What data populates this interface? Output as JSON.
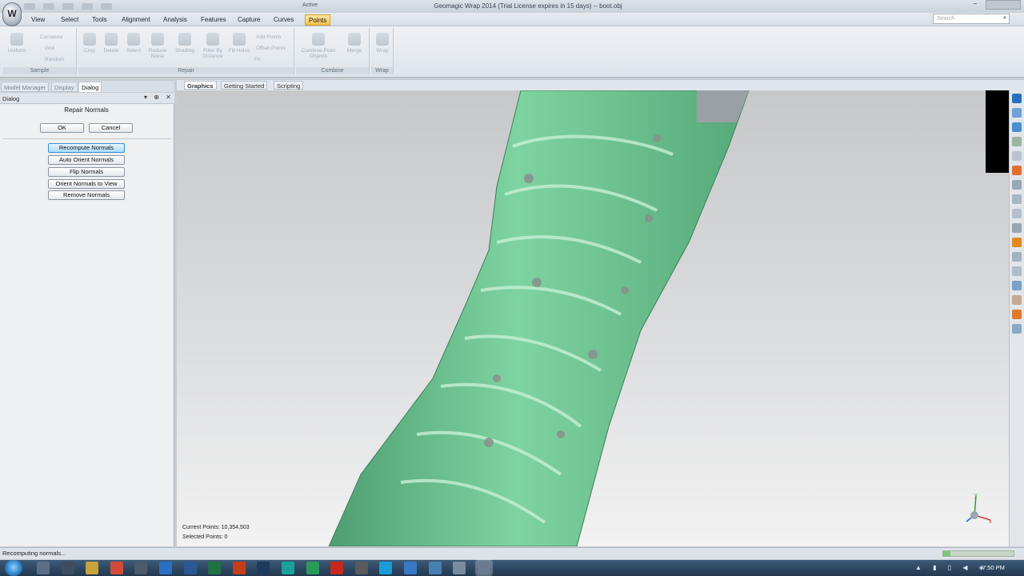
{
  "window": {
    "title": "Geomagic Wrap 2014 (Trial License expires in 15 days) -- boot.obj",
    "active_tag": "Active",
    "app_logo_letter": "W",
    "minimize_glyph": "–"
  },
  "menu": {
    "tabs": [
      "View",
      "Select",
      "Tools",
      "Alignment",
      "Analysis",
      "Features",
      "Capture",
      "Curves",
      "Points"
    ],
    "active": "Points"
  },
  "search": {
    "placeholder": "Search",
    "icon": "search-icon",
    "icon_glyph": "⌕"
  },
  "ribbon": {
    "groups": [
      {
        "label": "Sample",
        "buttons": [
          "Uniform"
        ],
        "small": [
          "Curvature",
          "Grid",
          "Random"
        ]
      },
      {
        "label": "Repair",
        "buttons": [
          "Crop",
          "Delete",
          "Select",
          "Reduce Noise",
          "Shading",
          "Filter By Distance",
          "Fill Holes"
        ],
        "small": [
          "Add Points",
          "Offset Points",
          "Fit"
        ]
      },
      {
        "label": "Combine",
        "buttons": [
          "Combine Point Objects",
          "Merge"
        ],
        "small": []
      },
      {
        "label": "Wrap",
        "buttons": [
          "Wrap"
        ],
        "small": []
      }
    ]
  },
  "panel": {
    "tabs": [
      "Model Manager",
      "Display",
      "Dialog"
    ],
    "active_tab": "Dialog",
    "header_title": "Dialog",
    "header_icons": "▾ ⊕ ✕",
    "dialog_title": "Repair Normals",
    "ok_label": "OK",
    "cancel_label": "Cancel",
    "actions": [
      "Recompute Normals",
      "Auto Orient Normals",
      "Flip Normals",
      "Orient Normals to View",
      "Remove Normals"
    ],
    "highlighted_action": "Recompute Normals"
  },
  "viewport": {
    "tabs": [
      "Graphics",
      "Getting Started",
      "Scripting"
    ],
    "active_tab": "Graphics",
    "current_points": "Current Points: 10,354,503",
    "selected_points": "Selected Points: 0",
    "model_color": "#7ed4a0",
    "axis_labels": {
      "y": "y",
      "x": "x"
    }
  },
  "status": {
    "text": "Recomputing normals...",
    "progress": 0.1
  },
  "taskbar": {
    "clock": "7:50 PM",
    "tray_glyphs": "▲ ▮ ▯ ◀ ◈",
    "apps": [
      {
        "icon": "explorer-icon",
        "color": "#5a6f86"
      },
      {
        "icon": "media-icon",
        "color": "#3d4d60"
      },
      {
        "icon": "folder-icon",
        "color": "#c9a23c"
      },
      {
        "icon": "chrome-icon",
        "color": "#d44a3a"
      },
      {
        "icon": "spider-icon",
        "color": "#4a5a6a"
      },
      {
        "icon": "outlook-icon",
        "color": "#2a6fc0"
      },
      {
        "icon": "word-icon",
        "color": "#2b5797"
      },
      {
        "icon": "excel-icon",
        "color": "#1f7244"
      },
      {
        "icon": "powerpoint-icon",
        "color": "#c43e1c"
      },
      {
        "icon": "photoshop-icon",
        "color": "#1c3a5c"
      },
      {
        "icon": "app-teal-icon",
        "color": "#1aa19a"
      },
      {
        "icon": "app-green-icon",
        "color": "#2a9a5a"
      },
      {
        "icon": "acrobat-icon",
        "color": "#c8281e"
      },
      {
        "icon": "inkscape-icon",
        "color": "#5a5a5a"
      },
      {
        "icon": "skype-icon",
        "color": "#1a9bd8"
      },
      {
        "icon": "app-blue-icon",
        "color": "#3a78c8"
      },
      {
        "icon": "network-icon",
        "color": "#4a80b0"
      },
      {
        "icon": "notepad-icon",
        "color": "#7a8aa0"
      },
      {
        "icon": "geomagic-icon",
        "color": "#6a7a90",
        "active": true
      }
    ]
  }
}
